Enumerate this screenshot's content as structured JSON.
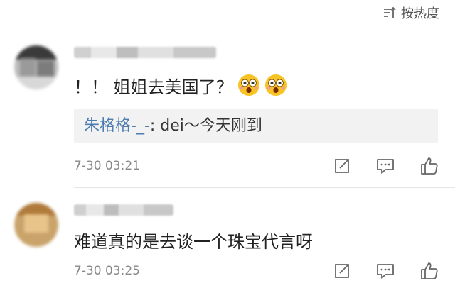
{
  "sort": {
    "label": "按热度",
    "icon": "sort-icon"
  },
  "comments": [
    {
      "text": "！！ 姐姐去美国了？",
      "emojis": [
        "surprised-emoji",
        "surprised-emoji"
      ],
      "reply": {
        "author": "朱格格-_-",
        "separator": ":",
        "content": " dei～今天刚到"
      },
      "time": "7-30 03:21"
    },
    {
      "text": "难道真的是去谈一个珠宝代言呀",
      "time": "7-30 03:25"
    }
  ],
  "actions": {
    "icons": [
      "share-icon",
      "comment-icon",
      "like-icon"
    ]
  },
  "colors": {
    "link": "#4d7cb0",
    "meta": "#888888",
    "reply_bg": "#f2f2f2"
  }
}
